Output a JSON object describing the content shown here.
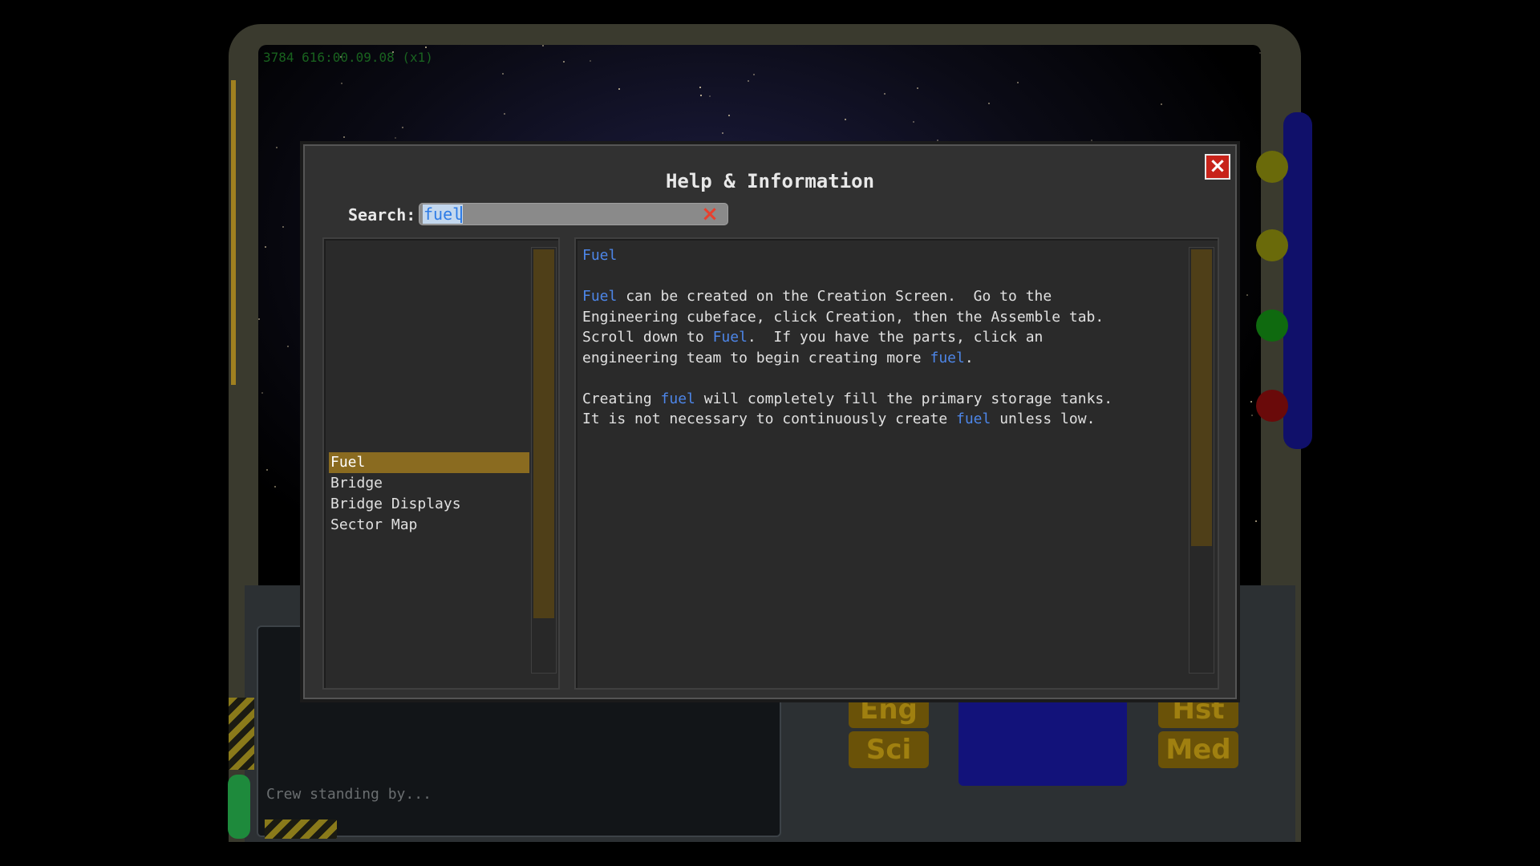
{
  "hud": {
    "coordinates": "3784 616:00.09.08 (x1)",
    "status": "Crew standing by...",
    "buttons": [
      "Eng",
      "Sci",
      "Med",
      "Hst"
    ],
    "indicator_colors": [
      "#8a8a10",
      "#8a8a10",
      "#1a8a1a",
      "#8a1010"
    ]
  },
  "dialog": {
    "title": "Help & Information",
    "close_icon": "close-x-icon",
    "search": {
      "label": "Search:",
      "value": "fuel",
      "clear_icon": "clear-x-icon"
    },
    "topics": [
      {
        "label": "Fuel",
        "selected": true
      },
      {
        "label": "Bridge",
        "selected": false
      },
      {
        "label": "Bridge Displays",
        "selected": false
      },
      {
        "label": "Sector Map",
        "selected": false
      }
    ],
    "article": {
      "title": "Fuel",
      "paragraphs": [
        "Fuel can be created on the Creation Screen.  Go to the\nEngineering cubeface, click Creation, then the Assemble tab.\nScroll down to Fuel.  If you have the parts, click an\nengineering team to begin creating more fuel.",
        "Creating fuel will completely fill the primary storage tanks.\nIt is not necessary to continuously create fuel unless low."
      ],
      "highlight_term": "fuel"
    }
  },
  "colors": {
    "accent": "#8a6b20",
    "link": "#4d86e8",
    "close": "#c8231a"
  }
}
